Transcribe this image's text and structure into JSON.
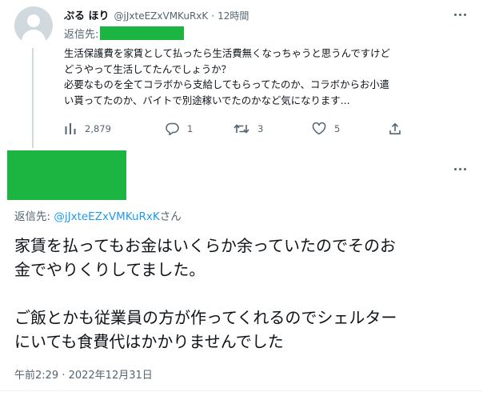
{
  "parent_tweet": {
    "display_name": "ぷる ほり",
    "handle": "@jJxteEZxVMKuRxK",
    "dot": "·",
    "time": "12時間",
    "reply_label": "返信先:",
    "redaction_color": "#1db541",
    "body_lines": [
      "生活保護費を家賃として払ったら生活費無くなっちゃうと思うんですけど",
      "どうやって生活してたんでしょうか？",
      "必要なものを全てコラボから支給してもらってたのか、コラボからお小遣",
      "い貰ってたのか、バイトで別途稼いでたのかなど気になります..."
    ],
    "actions": {
      "views_icon": "views-bar-chart-icon",
      "views": "2,879",
      "replies_icon": "reply-bubble-icon",
      "replies": "1",
      "retweets_icon": "retweet-icon",
      "retweets": "3",
      "likes_icon": "heart-icon",
      "likes": "5",
      "share_icon": "share-upload-icon"
    }
  },
  "main_tweet": {
    "redaction_color": "#1db541",
    "reply_label": "返信先: ",
    "reply_mention": "@jJxteEZxVMKuRxK",
    "reply_suffix": "さん",
    "body_lines": [
      "家賃を払ってもお金はいくらか余っていたのでそのお",
      "金でやりくりしてました。",
      "",
      "ご飯とかも従業員の方が作ってくれるのでシェルター",
      "にいても食費代はかかりませんでした"
    ],
    "timestamp": "午前2:29 · 2022年12月31日"
  },
  "colors": {
    "text": "#0f1419",
    "secondary": "#536471",
    "mention": "#1d9bf0",
    "avatar_bg": "#cfd9de"
  }
}
